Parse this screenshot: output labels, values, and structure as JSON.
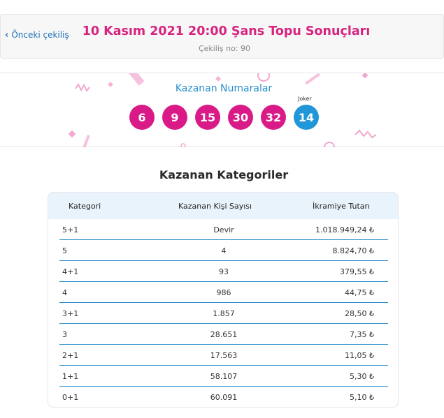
{
  "header": {
    "prev_label": "Önceki çekiliş",
    "title": "10 Kasım 2021 20:00 Şans Topu Sonuçları",
    "draw_no": "Çekiliş no: 90"
  },
  "numbers": {
    "title": "Kazanan Numaralar",
    "joker_label": "Joker",
    "balls": [
      "6",
      "9",
      "15",
      "30",
      "32"
    ],
    "joker": "14"
  },
  "categories": {
    "title": "Kazanan Kategoriler",
    "headers": [
      "Kategori",
      "Kazanan Kişi Sayısı",
      "İkramiye Tutarı"
    ],
    "rows": [
      {
        "cat": "5+1",
        "winners": "Devir",
        "prize": "1.018.949,24 ₺"
      },
      {
        "cat": "5",
        "winners": "4",
        "prize": "8.824,70 ₺"
      },
      {
        "cat": "4+1",
        "winners": "93",
        "prize": "379,55 ₺"
      },
      {
        "cat": "4",
        "winners": "986",
        "prize": "44,75 ₺"
      },
      {
        "cat": "3+1",
        "winners": "1.857",
        "prize": "28,50 ₺"
      },
      {
        "cat": "3",
        "winners": "28.651",
        "prize": "7,35 ₺"
      },
      {
        "cat": "2+1",
        "winners": "17.563",
        "prize": "11,05 ₺"
      },
      {
        "cat": "1+1",
        "winners": "58.107",
        "prize": "5,30 ₺"
      },
      {
        "cat": "0+1",
        "winners": "60.091",
        "prize": "5,10 ₺"
      }
    ]
  },
  "colors": {
    "accent_pink": "#d91a87",
    "accent_blue": "#2196d8",
    "title_pink": "#d6247f"
  }
}
